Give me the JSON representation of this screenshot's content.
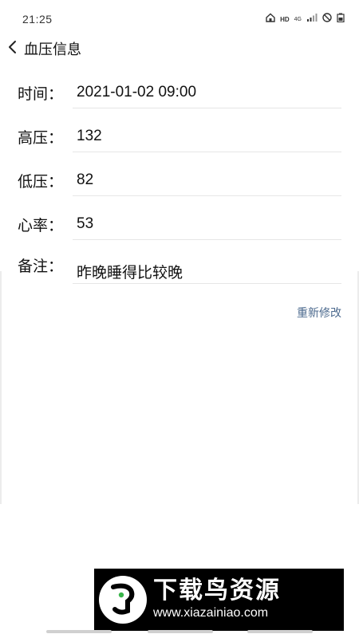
{
  "status_bar": {
    "time": "21:25",
    "hd": "HD",
    "network": "4G"
  },
  "header": {
    "title": "血压信息"
  },
  "fields": [
    {
      "label": "时间：",
      "value": "2021-01-02 09:00"
    },
    {
      "label": "高压：",
      "value": "132"
    },
    {
      "label": "低压：",
      "value": "82"
    },
    {
      "label": "心率：",
      "value": "53"
    },
    {
      "label": "备注：",
      "value": "昨晚睡得比较晚"
    }
  ],
  "actions": {
    "re_edit": "重新修改"
  },
  "watermark": {
    "title": "下载鸟资源",
    "url": "www.xiazainiao.com"
  },
  "icons": {
    "back": "chevron-left-icon",
    "home": "home-icon",
    "signal": "signal-icon",
    "dnd": "do-not-disturb-icon",
    "battery": "battery-icon"
  },
  "colors": {
    "link": "#4c6a8e",
    "divider": "#e6e6e6"
  }
}
